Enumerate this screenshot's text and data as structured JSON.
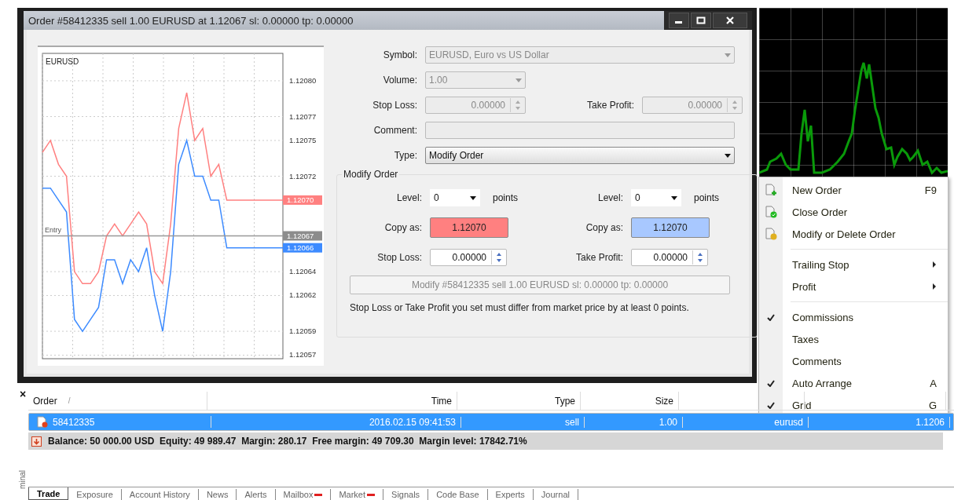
{
  "dialog": {
    "title": "Order #58412335 sell 1.00 EURUSD at 1.12067 sl: 0.00000 tp: 0.00000",
    "chart_data": {
      "type": "line",
      "title": "EURUSD",
      "ylim": [
        1.120567,
        1.120823
      ],
      "yticks": [
        {
          "value": 1.1208,
          "label": "1.12080"
        },
        {
          "value": 1.12077,
          "label": "1.12077"
        },
        {
          "value": 1.12075,
          "label": "1.12075"
        },
        {
          "value": 1.12072,
          "label": "1.12072"
        },
        {
          "value": 1.12064,
          "label": "1.12064"
        },
        {
          "value": 1.12062,
          "label": "1.12062"
        },
        {
          "value": 1.12059,
          "label": "1.12059"
        },
        {
          "value": 1.12057,
          "label": "1.12057"
        }
      ],
      "series": [
        {
          "color": "#ff8080",
          "values": [
            1.12074,
            1.12075,
            1.12073,
            1.12072,
            1.12064,
            1.12063,
            1.12063,
            1.12064,
            1.12067,
            1.12068,
            1.12067,
            1.12068,
            1.12069,
            1.12068,
            1.12064,
            1.12063,
            1.12068,
            1.12076,
            1.12079,
            1.12075,
            1.12076,
            1.12072,
            1.12073,
            1.1207,
            1.1207,
            1.1207,
            1.1207,
            1.1207,
            1.1207,
            1.1207,
            1.1207
          ]
        },
        {
          "color": "#3d8bff",
          "values": [
            1.12071,
            1.12071,
            1.1207,
            1.12069,
            1.1206,
            1.12059,
            1.1206,
            1.12061,
            1.12065,
            1.12065,
            1.12063,
            1.12065,
            1.12064,
            1.12066,
            1.12062,
            1.12059,
            1.12064,
            1.12073,
            1.12075,
            1.12072,
            1.12072,
            1.1207,
            1.1207,
            1.12066,
            1.12066,
            1.12066,
            1.12066,
            1.12066,
            1.12066,
            1.12066,
            1.12066
          ]
        }
      ],
      "grid": true,
      "ref_lines": [
        {
          "axis": "y",
          "value": 1.12067,
          "label": "Entry"
        }
      ],
      "annotations": [
        "1.12070",
        "1.12067",
        "1.12066"
      ]
    },
    "fields": [
      {
        "kind": "select",
        "label": "Symbol:",
        "value": "EURUSD, Euro vs US Dollar",
        "disabled": true
      },
      {
        "kind": "select-short",
        "label": "Volume:",
        "value": "1.00",
        "disabled": true
      },
      {
        "kind": "spin-pair",
        "label": "Stop Loss:",
        "value": "0.00000",
        "label2": "Take Profit:",
        "value2": "0.00000",
        "disabled": true
      },
      {
        "kind": "text",
        "label": "Comment:",
        "disabled": true
      },
      {
        "kind": "select",
        "label": "Type:",
        "value": "Modify Order",
        "disabled": false
      }
    ],
    "modify": {
      "title": "Modify Order",
      "sides": [
        {
          "level_label": "Level:",
          "level_value": "0",
          "units": "points",
          "copy_label": "Copy as:",
          "copy_value": "1.12070",
          "color": "#ff8080",
          "stop_label": "Stop Loss:",
          "stop_value": "0.00000"
        },
        {
          "level_label": "Level:",
          "level_value": "0",
          "units": "points",
          "copy_label": "Copy as:",
          "copy_value": "1.12070",
          "color": "#a8c8ff",
          "stop_label": "Take Profit:",
          "stop_value": "0.00000"
        }
      ],
      "button": {
        "label": "Modify  #58412335 sell 1.00 EURUSD sl: 0.00000 tp: 0.00000",
        "disabled": true
      },
      "note": "Stop Loss or Take Profit you set must differ from market price by at least 0 points."
    }
  },
  "context_menu": [
    {
      "kind": "order-new",
      "label": "New Order",
      "shortcut": "F9"
    },
    {
      "kind": "order-close",
      "label": "Close Order"
    },
    {
      "kind": "order-modify",
      "label": "Modify or Delete Order"
    },
    {
      "kind": "separator"
    },
    {
      "kind": "submenu",
      "label": "Trailing Stop"
    },
    {
      "kind": "submenu",
      "label": "Profit"
    },
    {
      "kind": "separator"
    },
    {
      "kind": "check",
      "label": "Commissions",
      "checked": true
    },
    {
      "kind": "check",
      "label": "Taxes",
      "checked": false
    },
    {
      "kind": "check",
      "label": "Comments",
      "checked": false
    },
    {
      "kind": "check",
      "label": "Auto Arrange",
      "checked": true,
      "shortcut": "A"
    },
    {
      "kind": "check",
      "label": "Grid",
      "checked": true,
      "shortcut": "G"
    }
  ],
  "terminal": {
    "side_label": "minal",
    "close": "×",
    "columns": [
      "Order",
      "Time",
      "Type",
      "Size"
    ],
    "sort_mark": "/",
    "rows": [
      {
        "cells": [
          "58412335",
          "2016.02.15 09:41:53",
          "sell",
          "1.00",
          "eurusd",
          "1.1206"
        ],
        "selected": true
      }
    ],
    "balance": "Balance: 50 000.00 USD  Equity: 49 989.47  Margin: 280.17  Free margin: 49 709.30  Margin level: 17842.71%",
    "tabs": [
      {
        "label": "Trade",
        "selected": true,
        "badge": false
      },
      {
        "label": "Exposure",
        "selected": false,
        "badge": false
      },
      {
        "label": "Account History",
        "selected": false,
        "badge": false
      },
      {
        "label": "News",
        "selected": false,
        "badge": false
      },
      {
        "label": "Alerts",
        "selected": false,
        "badge": false
      },
      {
        "label": "Mailbox",
        "selected": false,
        "badge": true
      },
      {
        "label": "Market",
        "selected": false,
        "badge": true
      },
      {
        "label": "Signals",
        "selected": false,
        "badge": false
      },
      {
        "label": "Code Base",
        "selected": false,
        "badge": false
      },
      {
        "label": "Experts",
        "selected": false,
        "badge": false
      },
      {
        "label": "Journal",
        "selected": false,
        "badge": false
      }
    ]
  }
}
